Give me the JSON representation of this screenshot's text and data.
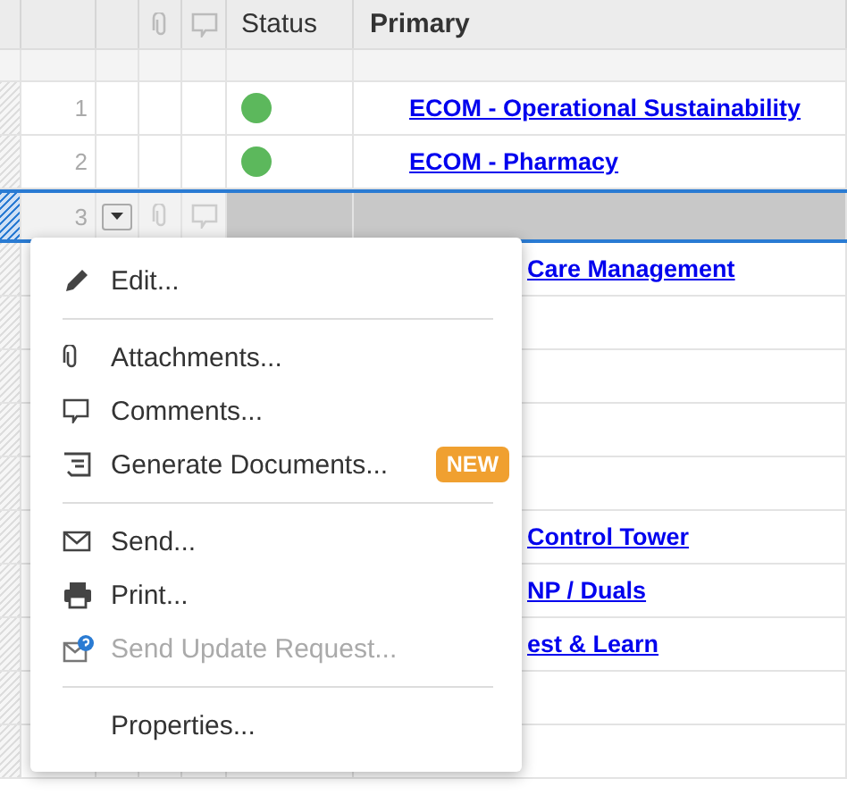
{
  "header": {
    "status": "Status",
    "primary": "Primary"
  },
  "rows": [
    {
      "number": "1",
      "color": "#5cb85c",
      "primary": "ECOM - Operational Sustainability",
      "selected": false
    },
    {
      "number": "2",
      "color": "#5cb85c",
      "primary": "ECOM - Pharmacy",
      "selected": false
    },
    {
      "number": "3",
      "selected": true
    },
    {
      "primary": "Care Management",
      "selected": false
    },
    {
      "selected": false
    },
    {
      "selected": false
    },
    {
      "selected": false
    },
    {
      "selected": false
    },
    {
      "primary": "Control Tower",
      "selected": false
    },
    {
      "primary": "NP / Duals",
      "selected": false
    },
    {
      "primary": "est & Learn",
      "selected": false
    },
    {
      "selected": false
    },
    {
      "selected": false
    }
  ],
  "menu": [
    {
      "kind": "edit",
      "label": "Edit...",
      "disabled": false
    },
    {
      "kind": "divider"
    },
    {
      "kind": "attachments",
      "label": "Attachments...",
      "disabled": false
    },
    {
      "kind": "comments",
      "label": "Comments...",
      "disabled": false
    },
    {
      "kind": "generate",
      "label": "Generate Documents...",
      "disabled": false,
      "badge": "NEW"
    },
    {
      "kind": "divider"
    },
    {
      "kind": "send",
      "label": "Send...",
      "disabled": false
    },
    {
      "kind": "print",
      "label": "Print...",
      "disabled": false
    },
    {
      "kind": "request",
      "label": "Send Update Request...",
      "disabled": true
    },
    {
      "kind": "divider"
    },
    {
      "kind": "properties",
      "label": "Properties...",
      "disabled": false
    }
  ]
}
